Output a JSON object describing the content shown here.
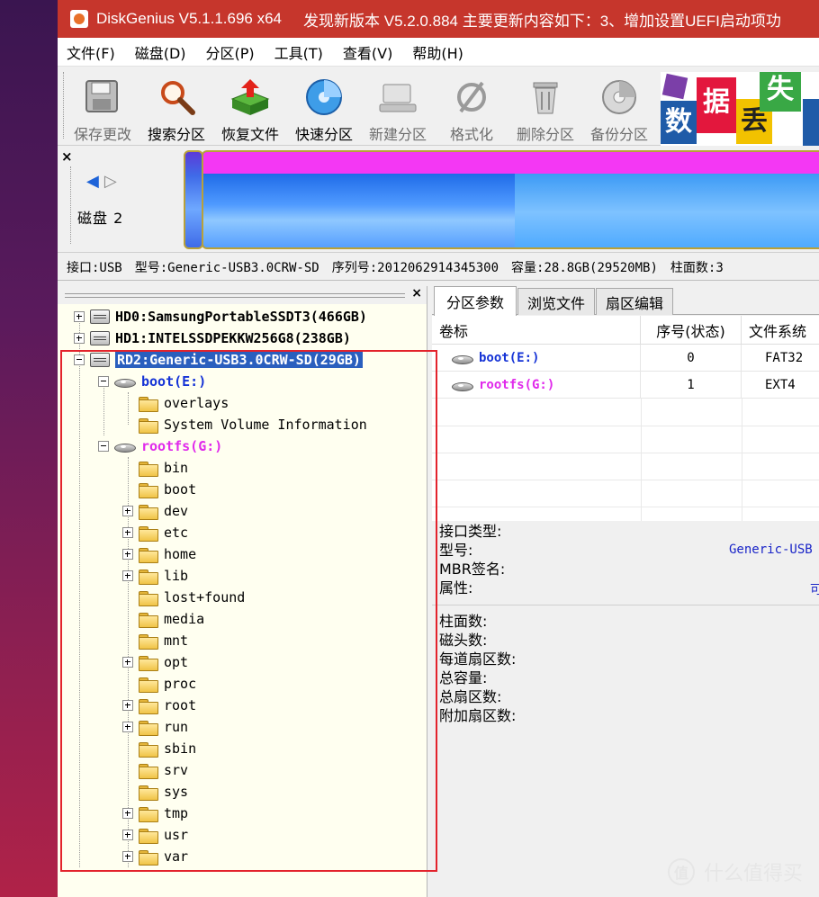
{
  "window": {
    "title": "DiskGenius V5.1.1.696 x64",
    "update_notice": "发现新版本 V5.2.0.884 主要更新内容如下：3、增加设置UEFI启动项功"
  },
  "menu": [
    "文件(F)",
    "磁盘(D)",
    "分区(P)",
    "工具(T)",
    "查看(V)",
    "帮助(H)"
  ],
  "toolbar": [
    {
      "label": "保存更改",
      "icon": "save-icon",
      "enabled": false
    },
    {
      "label": "搜索分区",
      "icon": "magnifier-icon",
      "enabled": true
    },
    {
      "label": "恢复文件",
      "icon": "recover-files-icon",
      "enabled": true
    },
    {
      "label": "快速分区",
      "icon": "quick-partition-disc-icon",
      "enabled": true
    },
    {
      "label": "新建分区",
      "icon": "new-partition-icon",
      "enabled": false
    },
    {
      "label": "格式化",
      "icon": "format-icon",
      "enabled": false
    },
    {
      "label": "删除分区",
      "icon": "delete-partition-icon",
      "enabled": false
    },
    {
      "label": "备份分区",
      "icon": "backup-partition-icon",
      "enabled": false
    }
  ],
  "ad_banner": {
    "chars": [
      "数",
      "据",
      "丢",
      "失"
    ],
    "colors": [
      "#1f5ba8",
      "#e3173d",
      "#f2c200",
      "#39a845"
    ]
  },
  "disk_map": {
    "disk_label": "磁盘 2",
    "colors": {
      "magenta": "#f437f4",
      "blue": "#2f7df2",
      "light_blue": "#6fb5ff"
    }
  },
  "disk_info": {
    "interface": "接口:USB",
    "model": "型号:Generic-USB3.0CRW-SD",
    "serial": "序列号:2012062914345300",
    "capacity": "容量:28.8GB(29520MB)",
    "cylinders": "柱面数:3"
  },
  "tree": {
    "disks": [
      {
        "label": "HD0:SamsungPortableSSDT3(466GB)"
      },
      {
        "label": "HD1:INTELSSDPEKKW256G8(238GB)"
      },
      {
        "label": "RD2:Generic-USB3.0CRW-SD(29GB)",
        "selected": true
      }
    ],
    "boot": {
      "label": "boot(E:)",
      "children": [
        "overlays",
        "System Volume Information"
      ]
    },
    "rootfs": {
      "label": "rootfs(G:)",
      "children": [
        {
          "name": "bin",
          "expandable": false
        },
        {
          "name": "boot",
          "expandable": false
        },
        {
          "name": "dev",
          "expandable": true
        },
        {
          "name": "etc",
          "expandable": true
        },
        {
          "name": "home",
          "expandable": true
        },
        {
          "name": "lib",
          "expandable": true
        },
        {
          "name": "lost+found",
          "expandable": false
        },
        {
          "name": "media",
          "expandable": false
        },
        {
          "name": "mnt",
          "expandable": false
        },
        {
          "name": "opt",
          "expandable": true
        },
        {
          "name": "proc",
          "expandable": false
        },
        {
          "name": "root",
          "expandable": true
        },
        {
          "name": "run",
          "expandable": true
        },
        {
          "name": "sbin",
          "expandable": false
        },
        {
          "name": "srv",
          "expandable": false
        },
        {
          "name": "sys",
          "expandable": false
        },
        {
          "name": "tmp",
          "expandable": true
        },
        {
          "name": "usr",
          "expandable": true
        },
        {
          "name": "var",
          "expandable": true
        }
      ]
    }
  },
  "tabs": [
    "分区参数",
    "浏览文件",
    "扇区编辑"
  ],
  "partition_table": {
    "headers": [
      "卷标",
      "序号(状态)",
      "文件系统"
    ],
    "rows": [
      {
        "label": "boot(E:)",
        "index": "0",
        "fs": "FAT32"
      },
      {
        "label": "rootfs(G:)",
        "index": "1",
        "fs": "EXT4"
      }
    ]
  },
  "properties_1": {
    "labels": [
      "接口类型:",
      "型号:",
      "MBR签名:",
      "属性:"
    ],
    "model_value": "Generic-USB",
    "attr_value": "可"
  },
  "properties_2": {
    "labels": [
      "柱面数:",
      "磁头数:",
      "每道扇区数:",
      "总容量:",
      "总扇区数:",
      "附加扇区数:"
    ]
  },
  "watermark": {
    "badge": "值",
    "text": "什么值得买"
  }
}
